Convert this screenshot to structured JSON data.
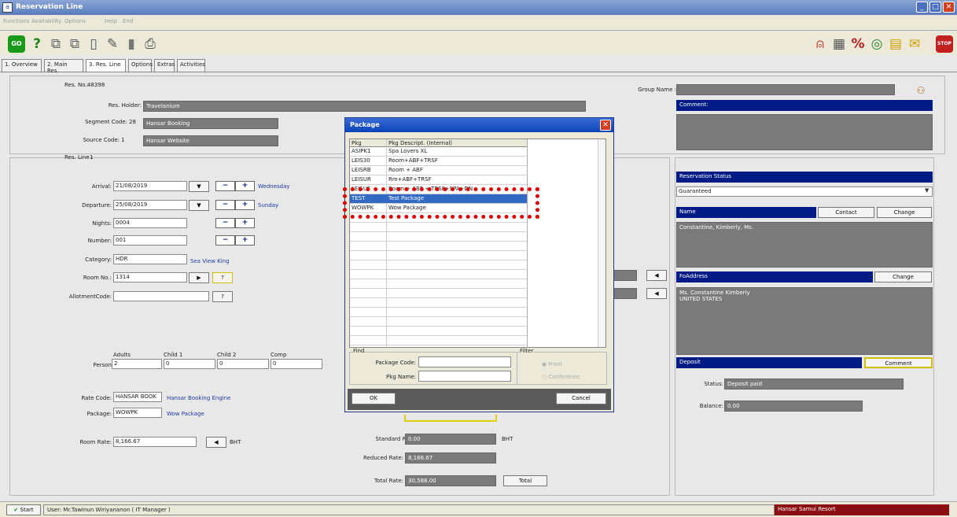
{
  "window": {
    "title": "Reservation Line",
    "icon": "a",
    "controls": [
      "_",
      "□",
      "✕"
    ]
  },
  "menu": [
    "Functions",
    "Availability",
    "Options",
    "Help",
    "End"
  ],
  "toolbar": {
    "left_icons": [
      "go-icon",
      "help-icon",
      "copy-icon",
      "copy2-icon",
      "new-doc-icon",
      "edit-doc-icon",
      "trash-icon",
      "print-icon"
    ],
    "right_icons": [
      "dining-icon",
      "calendar-icon",
      "discount-icon",
      "globe-icon",
      "note-icon",
      "envelope-icon",
      "stop-icon"
    ],
    "go_label": "GO",
    "stop_label": "STOP"
  },
  "tabs": [
    "1. Overview",
    "2. Main Res.",
    "3. Res. Line",
    "Options",
    "Extras",
    "Activities"
  ],
  "header": {
    "res_no_label": "Res. No.:",
    "res_no": "48398",
    "holder_label": "Res. Holder:",
    "holder": "Travelanium",
    "segment_label": "Segment Code:",
    "segment_code": "28",
    "segment_name": "Hansar Booking",
    "source_label": "Source Code:",
    "source_code": "1",
    "source_name": "Hansar Website",
    "group_label": "Group Name :",
    "group_name": "",
    "comment_label": "Comment:",
    "comment": ""
  },
  "resline": {
    "label": "Res. Line :",
    "number": "1",
    "arrival_label": "Arrival:",
    "arrival": "21/08/2019",
    "arrival_day": "Wednesday",
    "departure_label": "Departure:",
    "departure": "25/08/2019",
    "departure_day": "Sunday",
    "nights_label": "Nights:",
    "nights": "0004",
    "number_label": "Number:",
    "rooms": "001",
    "category_label": "Category:",
    "category": "HDR",
    "category_name": "Sea View King",
    "room_label": "Room No.:",
    "room": "1314",
    "allot_label": "AllotmentCode:",
    "allot": "",
    "persons_label": "Person",
    "adults_label": "Adults",
    "child1_label": "Child 1",
    "child2_label": "Child 2",
    "comp_label": "Comp",
    "adults": "2",
    "child1": "0",
    "child2": "0",
    "comp": "0",
    "rate_code_label": "Rate Code:",
    "rate_code": "HANSAR BOOK",
    "rate_code_name": "Hansar Booking Engine",
    "package_label": "Package:",
    "package": "WOWPK",
    "package_name": "Wow Package",
    "room_rate_label": "Room Rate:",
    "room_rate": "8,166.67",
    "currency": "BHT",
    "std_label": "Standard Rate:",
    "std_rate": "0.00",
    "std_cur": "BHT",
    "red_label": "Reduced Rate:",
    "red_rate": "8,166.67",
    "total_label": "Total Rate:",
    "total_rate": "30,588.00",
    "total_btn": "Total"
  },
  "right": {
    "status_hdr": "Reservation Status",
    "status": "Guaranteed",
    "name_hdr": "Name",
    "contact_btn": "Contact",
    "change_btn": "Change",
    "guest": "Constantine, Kimberly, Ms.",
    "fo_hdr": "FoAddress",
    "fo_change": "Change",
    "fo_line1": "Ms. Constantine Kimberly",
    "fo_line2": "UNITED STATES",
    "deposit_hdr": "Deposit",
    "comment_btn": "Comment",
    "dep_status_label": "Status:",
    "dep_status": "Deposit paid",
    "balance_label": "Balance:",
    "balance": "0.00"
  },
  "dialog": {
    "title": "Package",
    "col1": "Pkg",
    "col2": "Pkg Descript. (Internal)",
    "rows": [
      {
        "code": "ASIPK1",
        "desc": "Spa Lovers XL"
      },
      {
        "code": "LEIS30",
        "desc": "Room+ABF+TRSF"
      },
      {
        "code": "LEISRB",
        "desc": "Room + ABF"
      },
      {
        "code": "LEISUR",
        "desc": "Rm+ABF+TRSF"
      },
      {
        "code": "LEISUF",
        "desc": "Room + ABF + TRSF+SPA+DN"
      },
      {
        "code": "TEST",
        "desc": "Test Package"
      },
      {
        "code": "WOWPK",
        "desc": "Wow Package"
      }
    ],
    "selected": 5,
    "find_label": "Find",
    "filter_label": "Filter",
    "pkg_code_label": "Package Code:",
    "pkg_name_label": "Pkg Name:",
    "radio_front": "Front",
    "radio_conf": "Conference",
    "ok": "OK",
    "cancel": "Cancel"
  },
  "status": {
    "start": "Start",
    "user": "User: Mr.Tawinun Wiriyananon ( IT Manager )",
    "resort": "Hansar Samui Resort"
  },
  "colors": {
    "header_blue": "#001b85",
    "highlight": "#e00000",
    "select": "#316ac5"
  }
}
